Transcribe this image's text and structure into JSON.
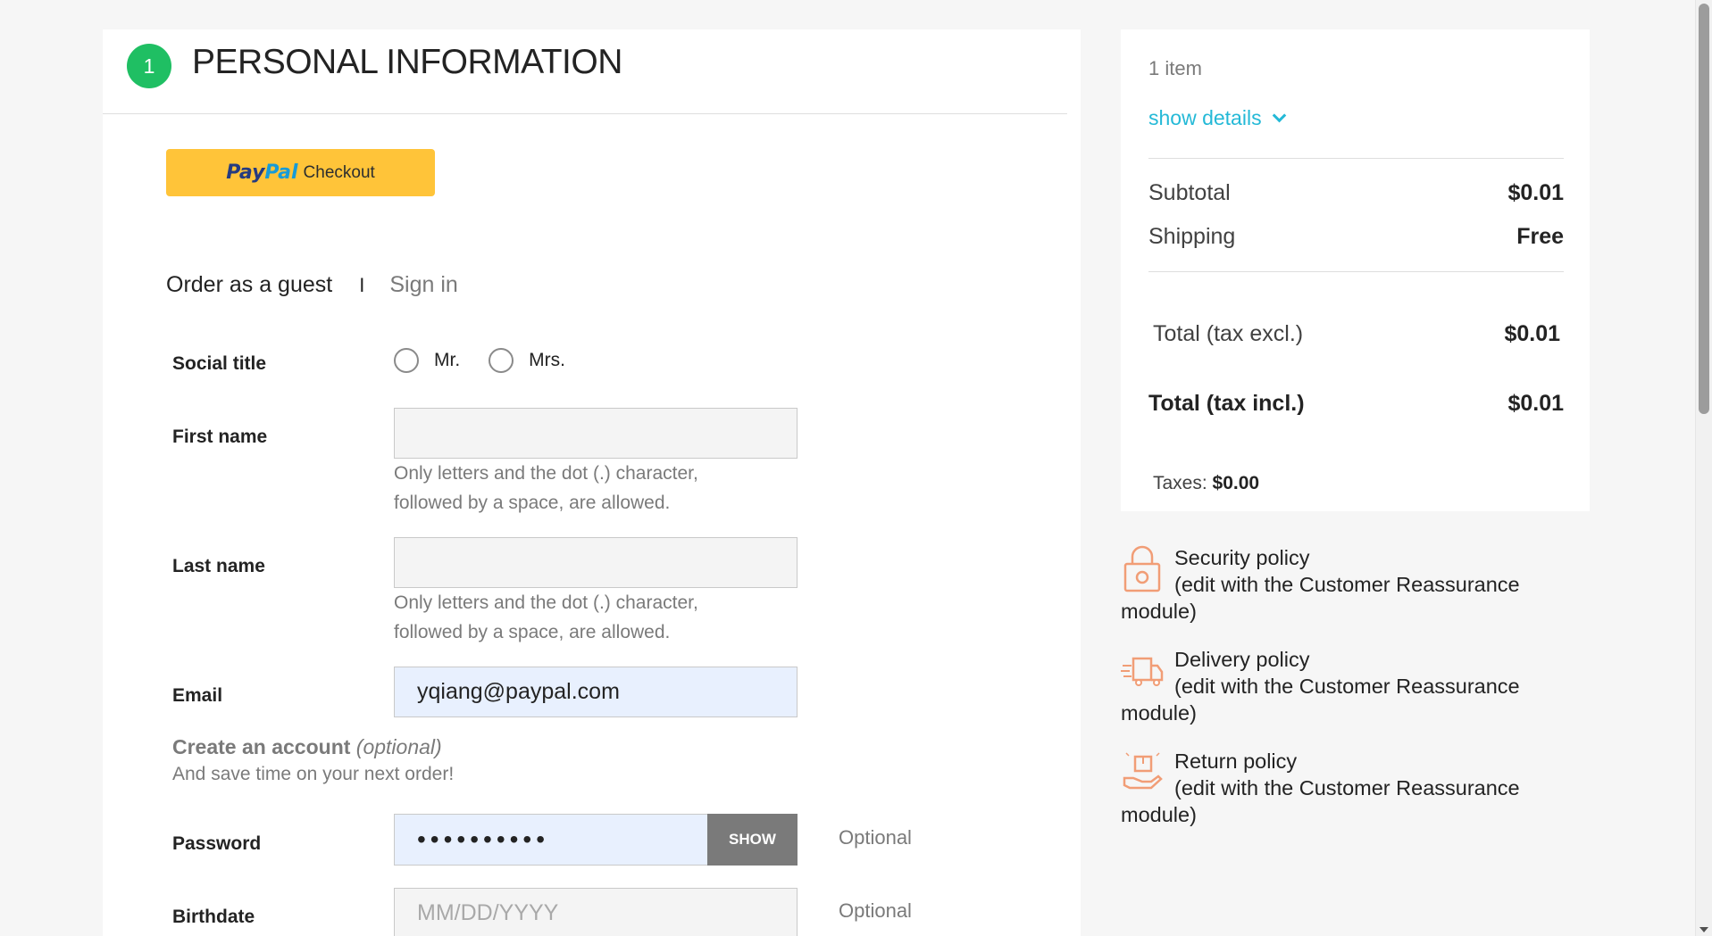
{
  "step": {
    "number": "1",
    "title": "PERSONAL INFORMATION"
  },
  "paypal": {
    "pay": "Pay",
    "pal": "Pal",
    "label": "Checkout"
  },
  "auth_tabs": {
    "guest": "Order as a guest",
    "separator": "I",
    "signin": "Sign in"
  },
  "form": {
    "social_title": {
      "label": "Social title",
      "options": [
        "Mr.",
        "Mrs."
      ]
    },
    "first_name": {
      "label": "First name",
      "value": "",
      "help": "Only letters and the dot (.) character, followed by a space, are allowed."
    },
    "last_name": {
      "label": "Last name",
      "value": "",
      "help": "Only letters and the dot (.) character, followed by a space, are allowed."
    },
    "email": {
      "label": "Email",
      "value": "yqiang@paypal.com"
    },
    "create_account": {
      "title": "Create an account",
      "optional": "(optional)",
      "subtitle": "And save time on your next order!"
    },
    "password": {
      "label": "Password",
      "masked_value": "••••••••••",
      "show_label": "SHOW",
      "optional": "Optional"
    },
    "birthdate": {
      "label": "Birthdate",
      "placeholder": "MM/DD/YYYY",
      "optional": "Optional"
    }
  },
  "summary": {
    "item_count": "1 item",
    "show_details": "show details",
    "subtotal": {
      "label": "Subtotal",
      "value": "$0.01"
    },
    "shipping": {
      "label": "Shipping",
      "value": "Free"
    },
    "total_excl": {
      "label": "Total (tax excl.)",
      "value": "$0.01"
    },
    "total_incl": {
      "label": "Total (tax incl.)",
      "value": "$0.01"
    },
    "taxes": {
      "label": "Taxes:",
      "value": "$0.00"
    }
  },
  "reassurance": [
    {
      "title": "Security policy",
      "desc": "(edit with the Customer Reassurance module)",
      "icon": "lock-icon"
    },
    {
      "title": "Delivery policy",
      "desc": "(edit with the Customer Reassurance module)",
      "icon": "delivery-truck-icon"
    },
    {
      "title": "Return policy",
      "desc": "(edit with the Customer Reassurance module)",
      "icon": "return-box-icon"
    }
  ],
  "colors": {
    "accent_green": "#1fbf63",
    "link_cyan": "#24b9d7",
    "paypal_yellow": "#ffc439",
    "reassurance_icon": "#f19d76"
  }
}
